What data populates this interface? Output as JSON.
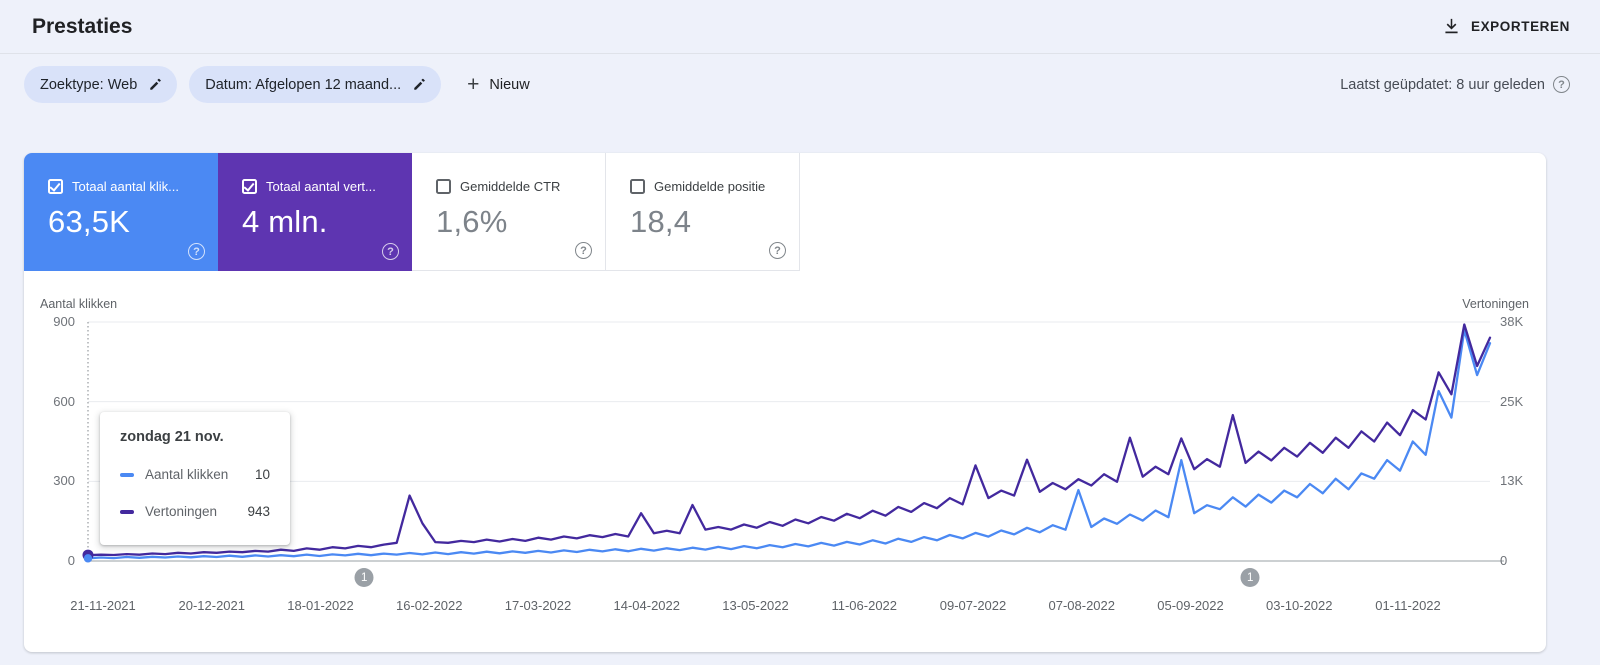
{
  "page": {
    "title": "Prestaties",
    "export_label": "EXPORTEREN",
    "last_updated": "Laatst geüpdatet: 8 uur geleden"
  },
  "filters": {
    "chips": [
      {
        "label": "Zoektype: Web"
      },
      {
        "label": "Datum: Afgelopen 12 maand..."
      }
    ],
    "new_label": "Nieuw"
  },
  "metrics": [
    {
      "label": "Totaal aantal klik...",
      "value": "63,5K",
      "checked": true,
      "color": "#4b89f3"
    },
    {
      "label": "Totaal aantal vert...",
      "value": "4 mln.",
      "checked": true,
      "color": "#5e35b1"
    },
    {
      "label": "Gemiddelde CTR",
      "value": "1,6%",
      "checked": false,
      "color": "#ffffff"
    },
    {
      "label": "Gemiddelde positie",
      "value": "18,4",
      "checked": false,
      "color": "#ffffff"
    }
  ],
  "tooltip": {
    "title": "zondag 21 nov.",
    "rows": [
      {
        "label": "Aantal klikken",
        "value": "10",
        "color": "#4b89f3"
      },
      {
        "label": "Vertoningen",
        "value": "943",
        "color": "#43299e"
      }
    ]
  },
  "chart_data": {
    "type": "line",
    "title": "",
    "axis_left_label": "Aantal klikken",
    "axis_right_label": "Vertoningen",
    "ylim_left": [
      0,
      900
    ],
    "ylim_right_k": [
      0,
      38
    ],
    "y_ticks_left": [
      "900",
      "600",
      "300",
      "0"
    ],
    "y_ticks_right": [
      "38K",
      "25K",
      "13K",
      "0"
    ],
    "grid": true,
    "x_tick_labels": [
      "21-11-2021",
      "20-12-2021",
      "18-01-2022",
      "16-02-2022",
      "17-03-2022",
      "14-04-2022",
      "13-05-2022",
      "11-06-2022",
      "09-07-2022",
      "07-08-2022",
      "05-09-2022",
      "03-10-2022",
      "01-11-2022"
    ],
    "annotations": [
      {
        "label": "1",
        "x_fraction": 0.197
      },
      {
        "label": "1",
        "x_fraction": 0.829
      }
    ],
    "highlight_point": {
      "date": "zondag 21 nov.",
      "clicks": 10,
      "impressions": 943,
      "x_fraction": 0
    },
    "series": [
      {
        "name": "Aantal klikken",
        "color": "#4b89f3",
        "axis": "left",
        "values": [
          10,
          13,
          11,
          15,
          12,
          16,
          13,
          17,
          14,
          18,
          15,
          20,
          16,
          21,
          17,
          22,
          18,
          24,
          19,
          25,
          21,
          27,
          22,
          28,
          24,
          30,
          25,
          32,
          26,
          33,
          28,
          35,
          29,
          36,
          31,
          38,
          32,
          40,
          34,
          42,
          36,
          44,
          37,
          46,
          39,
          48,
          41,
          50,
          43,
          53,
          45,
          56,
          48,
          60,
          52,
          64,
          55,
          68,
          58,
          72,
          62,
          78,
          66,
          84,
          72,
          90,
          78,
          98,
          85,
          106,
          92,
          115,
          100,
          125,
          108,
          135,
          118,
          267,
          128,
          160,
          140,
          175,
          152,
          190,
          165,
          380,
          180,
          210,
          195,
          240,
          205,
          250,
          220,
          265,
          240,
          290,
          255,
          310,
          270,
          330,
          310,
          380,
          340,
          450,
          400,
          640,
          540,
          870,
          700,
          820
        ]
      },
      {
        "name": "Vertoningen",
        "color": "#43299e",
        "axis": "right",
        "unit": "thousands",
        "values": [
          0.94,
          1.0,
          0.95,
          1.1,
          1.0,
          1.2,
          1.1,
          1.3,
          1.2,
          1.4,
          1.3,
          1.5,
          1.4,
          1.6,
          1.5,
          1.8,
          1.6,
          2.0,
          1.8,
          2.2,
          2.0,
          2.4,
          2.2,
          2.6,
          2.9,
          10.4,
          6.0,
          3.0,
          2.9,
          3.2,
          3.0,
          3.4,
          3.1,
          3.5,
          3.2,
          3.7,
          3.4,
          3.9,
          3.6,
          4.1,
          3.8,
          4.3,
          3.9,
          7.6,
          4.4,
          4.8,
          4.4,
          8.9,
          5.0,
          5.4,
          5.0,
          5.8,
          5.3,
          6.2,
          5.6,
          6.6,
          6.0,
          7.0,
          6.4,
          7.5,
          6.8,
          8.0,
          7.2,
          8.6,
          7.8,
          9.2,
          8.4,
          10.0,
          9.0,
          15.2,
          10.0,
          11.2,
          10.4,
          16.1,
          11.0,
          12.4,
          11.4,
          13.0,
          12.0,
          13.8,
          12.6,
          19.6,
          13.4,
          15.0,
          13.8,
          19.5,
          14.6,
          16.2,
          15.0,
          23.2,
          15.6,
          17.4,
          16.0,
          18.0,
          16.6,
          18.8,
          17.2,
          19.6,
          18.0,
          20.6,
          19.0,
          22.0,
          20.0,
          24.0,
          22.5,
          30.0,
          26.5,
          37.6,
          31.0,
          35.5
        ]
      }
    ]
  }
}
